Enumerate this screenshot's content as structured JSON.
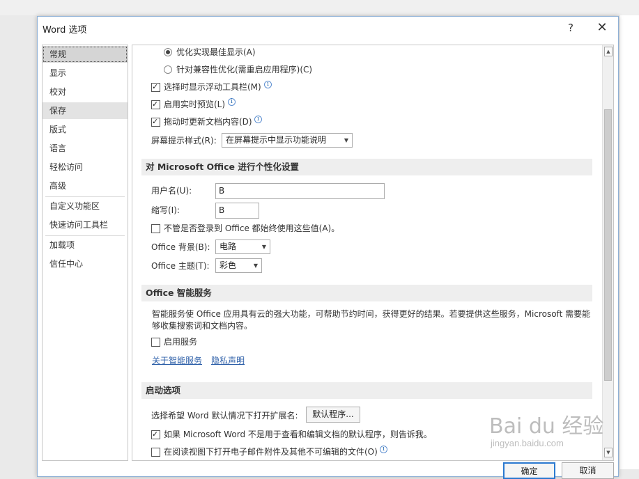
{
  "window": {
    "title": "Word 选项",
    "help": "?",
    "close": "✕"
  },
  "nav": {
    "items": [
      {
        "label": "常规",
        "state": "selected"
      },
      {
        "label": "显示"
      },
      {
        "label": "校对"
      },
      {
        "label": "保存",
        "state": "hover"
      },
      {
        "label": "版式"
      },
      {
        "label": "语言"
      },
      {
        "label": "轻松访问"
      },
      {
        "label": "高级"
      },
      {
        "label": "自定义功能区"
      },
      {
        "label": "快速访问工具栏"
      },
      {
        "label": "加载项"
      },
      {
        "label": "信任中心"
      }
    ]
  },
  "ui_options": {
    "radio_best": "优化实现最佳显示(A)",
    "radio_compat": "针对兼容性优化(需重启应用程序)(C)",
    "chk_minitoolbar": "选择时显示浮动工具栏(M)",
    "chk_livepreview": "启用实时预览(L)",
    "chk_dragupdate": "拖动时更新文档内容(D)",
    "screentip_label": "屏幕提示样式(R):",
    "screentip_value": "在屏幕提示中显示功能说明"
  },
  "personalize": {
    "header": "对 Microsoft Office 进行个性化设置",
    "username_label": "用户名(U):",
    "username_value": "B",
    "initials_label": "缩写(I):",
    "initials_value": "B",
    "always_use": "不管是否登录到 Office 都始终使用这些值(A)。",
    "background_label": "Office 背景(B):",
    "background_value": "电路",
    "theme_label": "Office 主题(T):",
    "theme_value": "彩色"
  },
  "intelligent": {
    "header": "Office 智能服务",
    "desc_line1": "智能服务使 Office 应用具有云的强大功能，可帮助节约时间，获得更好的结果。若要提供这些服务，Microsoft 需要能",
    "desc_line2": "够收集搜索词和文档内容。",
    "enable": "启用服务",
    "link_about": "关于智能服务",
    "link_privacy": "隐私声明"
  },
  "startup": {
    "header": "启动选项",
    "ext_label": "选择希望 Word 默认情况下打开扩展名:",
    "default_programs": "默认程序...",
    "tell_me": "如果 Microsoft Word 不是用于查看和编辑文档的默认程序，则告诉我。",
    "open_reading": "在阅读视图下打开电子邮件附件及其他不可编辑的文件(O)"
  },
  "footer": {
    "ok": "确定",
    "cancel": "取消"
  },
  "watermark": {
    "main": "Bai du 经验",
    "sub": "jingyan.baidu.com"
  },
  "colors": {
    "accent": "#2b79d0",
    "link": "#2d5fa8",
    "section_bg": "#eeeeee"
  }
}
